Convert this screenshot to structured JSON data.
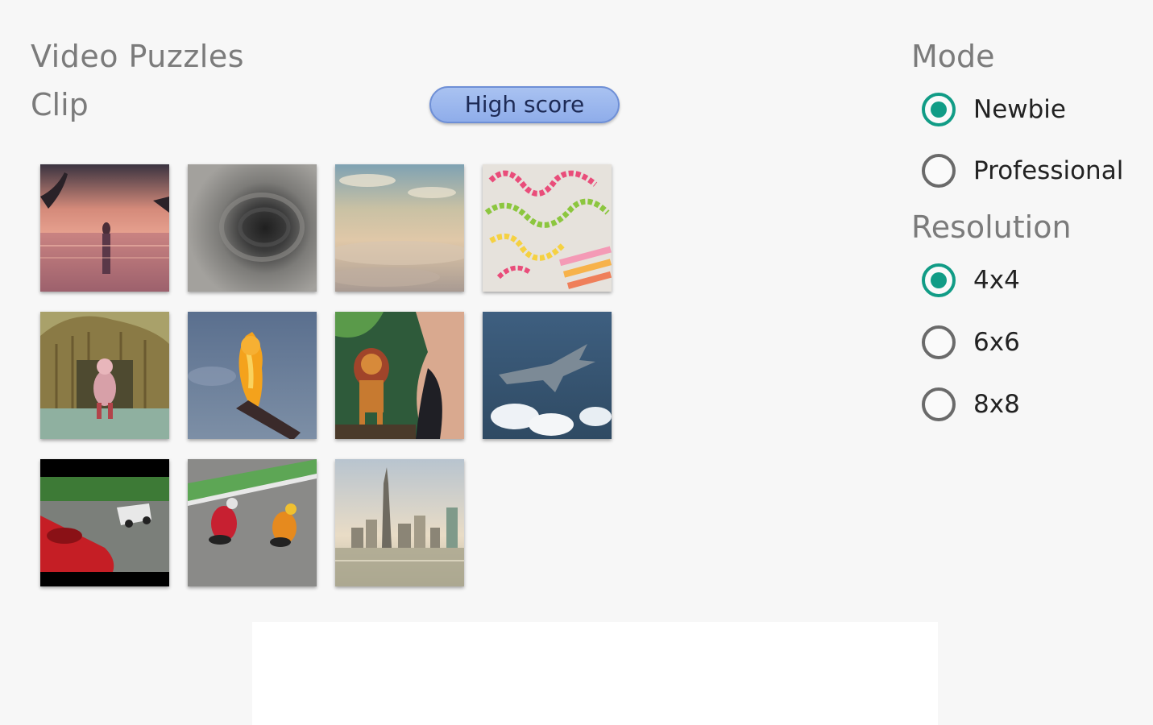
{
  "header": {
    "app_title": "Video Puzzles",
    "section_label": "Clip",
    "high_score_label": "High score"
  },
  "clips": [
    {
      "name": "clip-sunset-woman-icon"
    },
    {
      "name": "clip-vortex-icon"
    },
    {
      "name": "clip-clouds-icon"
    },
    {
      "name": "clip-colorful-beads-icon"
    },
    {
      "name": "clip-cartoon-hut-icon"
    },
    {
      "name": "clip-lion-king-flame-icon"
    },
    {
      "name": "clip-lion-king-jungle-icon"
    },
    {
      "name": "clip-jet-plane-icon"
    },
    {
      "name": "clip-race-cars-icon"
    },
    {
      "name": "clip-motorbike-race-icon"
    },
    {
      "name": "clip-city-skyline-icon"
    }
  ],
  "mode": {
    "label": "Mode",
    "options": [
      {
        "label": "Newbie",
        "checked": true
      },
      {
        "label": "Professional",
        "checked": false
      }
    ]
  },
  "resolution": {
    "label": "Resolution",
    "options": [
      {
        "label": "4x4",
        "checked": true
      },
      {
        "label": "6x6",
        "checked": false
      },
      {
        "label": "8x8",
        "checked": false
      }
    ]
  },
  "colors": {
    "accent": "#119c86",
    "button_bg": "#9cb7ee"
  }
}
